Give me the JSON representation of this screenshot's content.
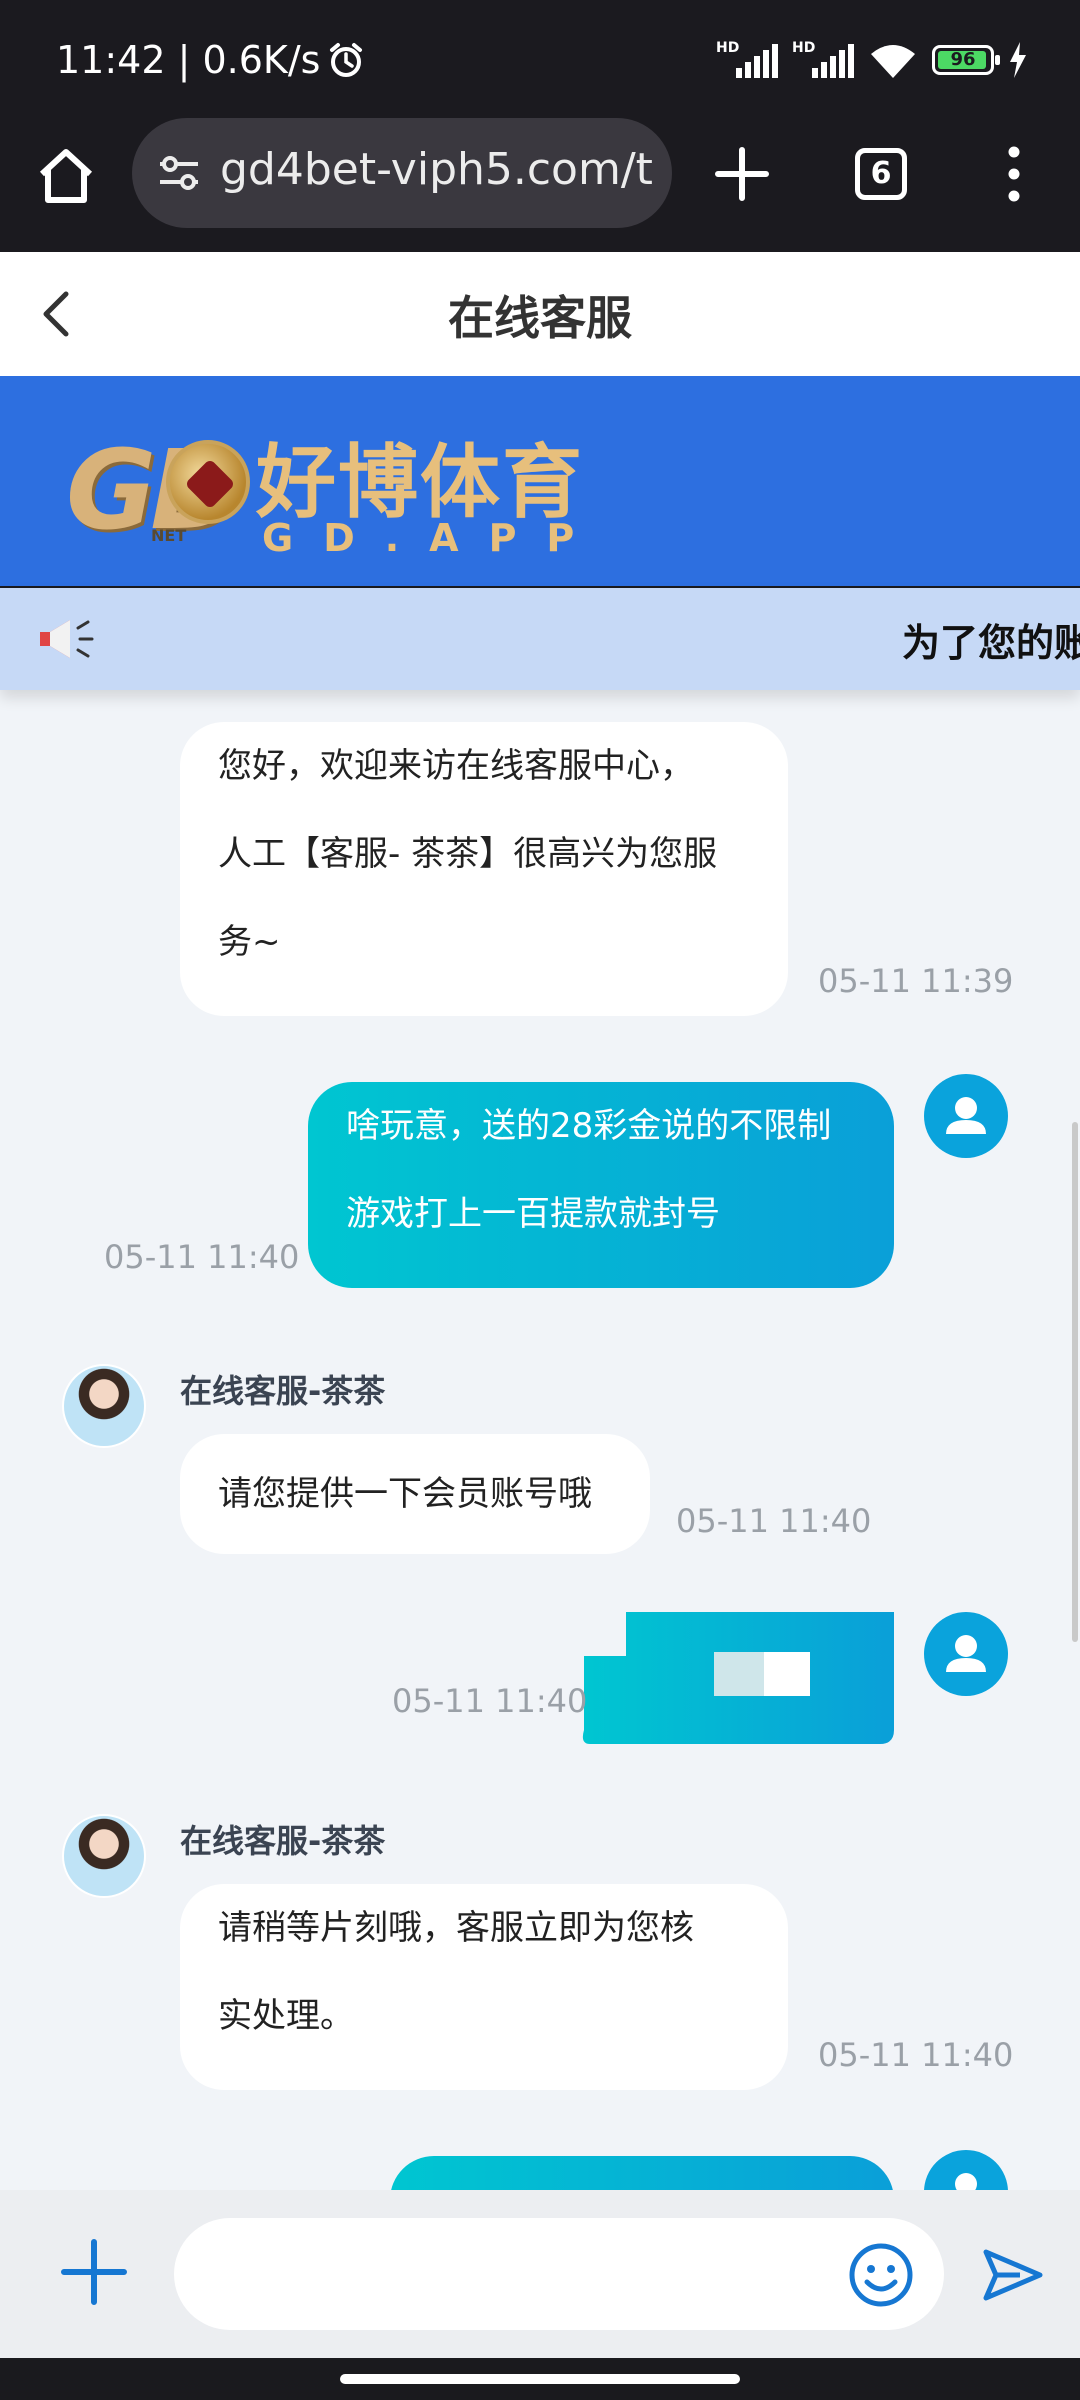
{
  "status_bar": {
    "time_speed": "11:42 | 0.6K/s",
    "hd1": "HD",
    "hd2": "HD",
    "battery": "96"
  },
  "browser": {
    "url": "gd4bet-viph5.com/t",
    "tab_count": "6"
  },
  "header": {
    "title": "在线客服"
  },
  "banner": {
    "logo_gd": "GD",
    "logo_net": "NET",
    "logo_cn": "好博体育",
    "logo_en": "GD.APP"
  },
  "notice": {
    "text": "为了您的账"
  },
  "messages": [
    {
      "side": "agent",
      "lines": [
        "您好，欢迎来访在线客服中心，",
        "人工【客服- 茶茶】很高兴为您服",
        "务~"
      ],
      "time": "05-11 11:39"
    },
    {
      "side": "user",
      "lines": [
        "啥玩意，送的28彩金说的不限制",
        "游戏打上一百提款就封号"
      ],
      "time": "05-11 11:40"
    },
    {
      "side": "agent",
      "name": "在线客服-茶茶",
      "lines": [
        "请您提供一下会员账号哦"
      ],
      "time": "05-11 11:40"
    },
    {
      "side": "user",
      "lines": [],
      "time": "05-11 11:40"
    },
    {
      "side": "agent",
      "name": "在线客服-茶茶",
      "lines": [
        "请稍等片刻哦，客服立即为您核",
        "实处理。"
      ],
      "time": "05-11 11:40"
    }
  ],
  "input": {
    "placeholder": ""
  },
  "colors": {
    "accent": "#2d6fe0",
    "user_bubble_start": "#00c6d1",
    "user_bubble_end": "#0a9fd8",
    "notice_bg": "#c6d9f6"
  }
}
